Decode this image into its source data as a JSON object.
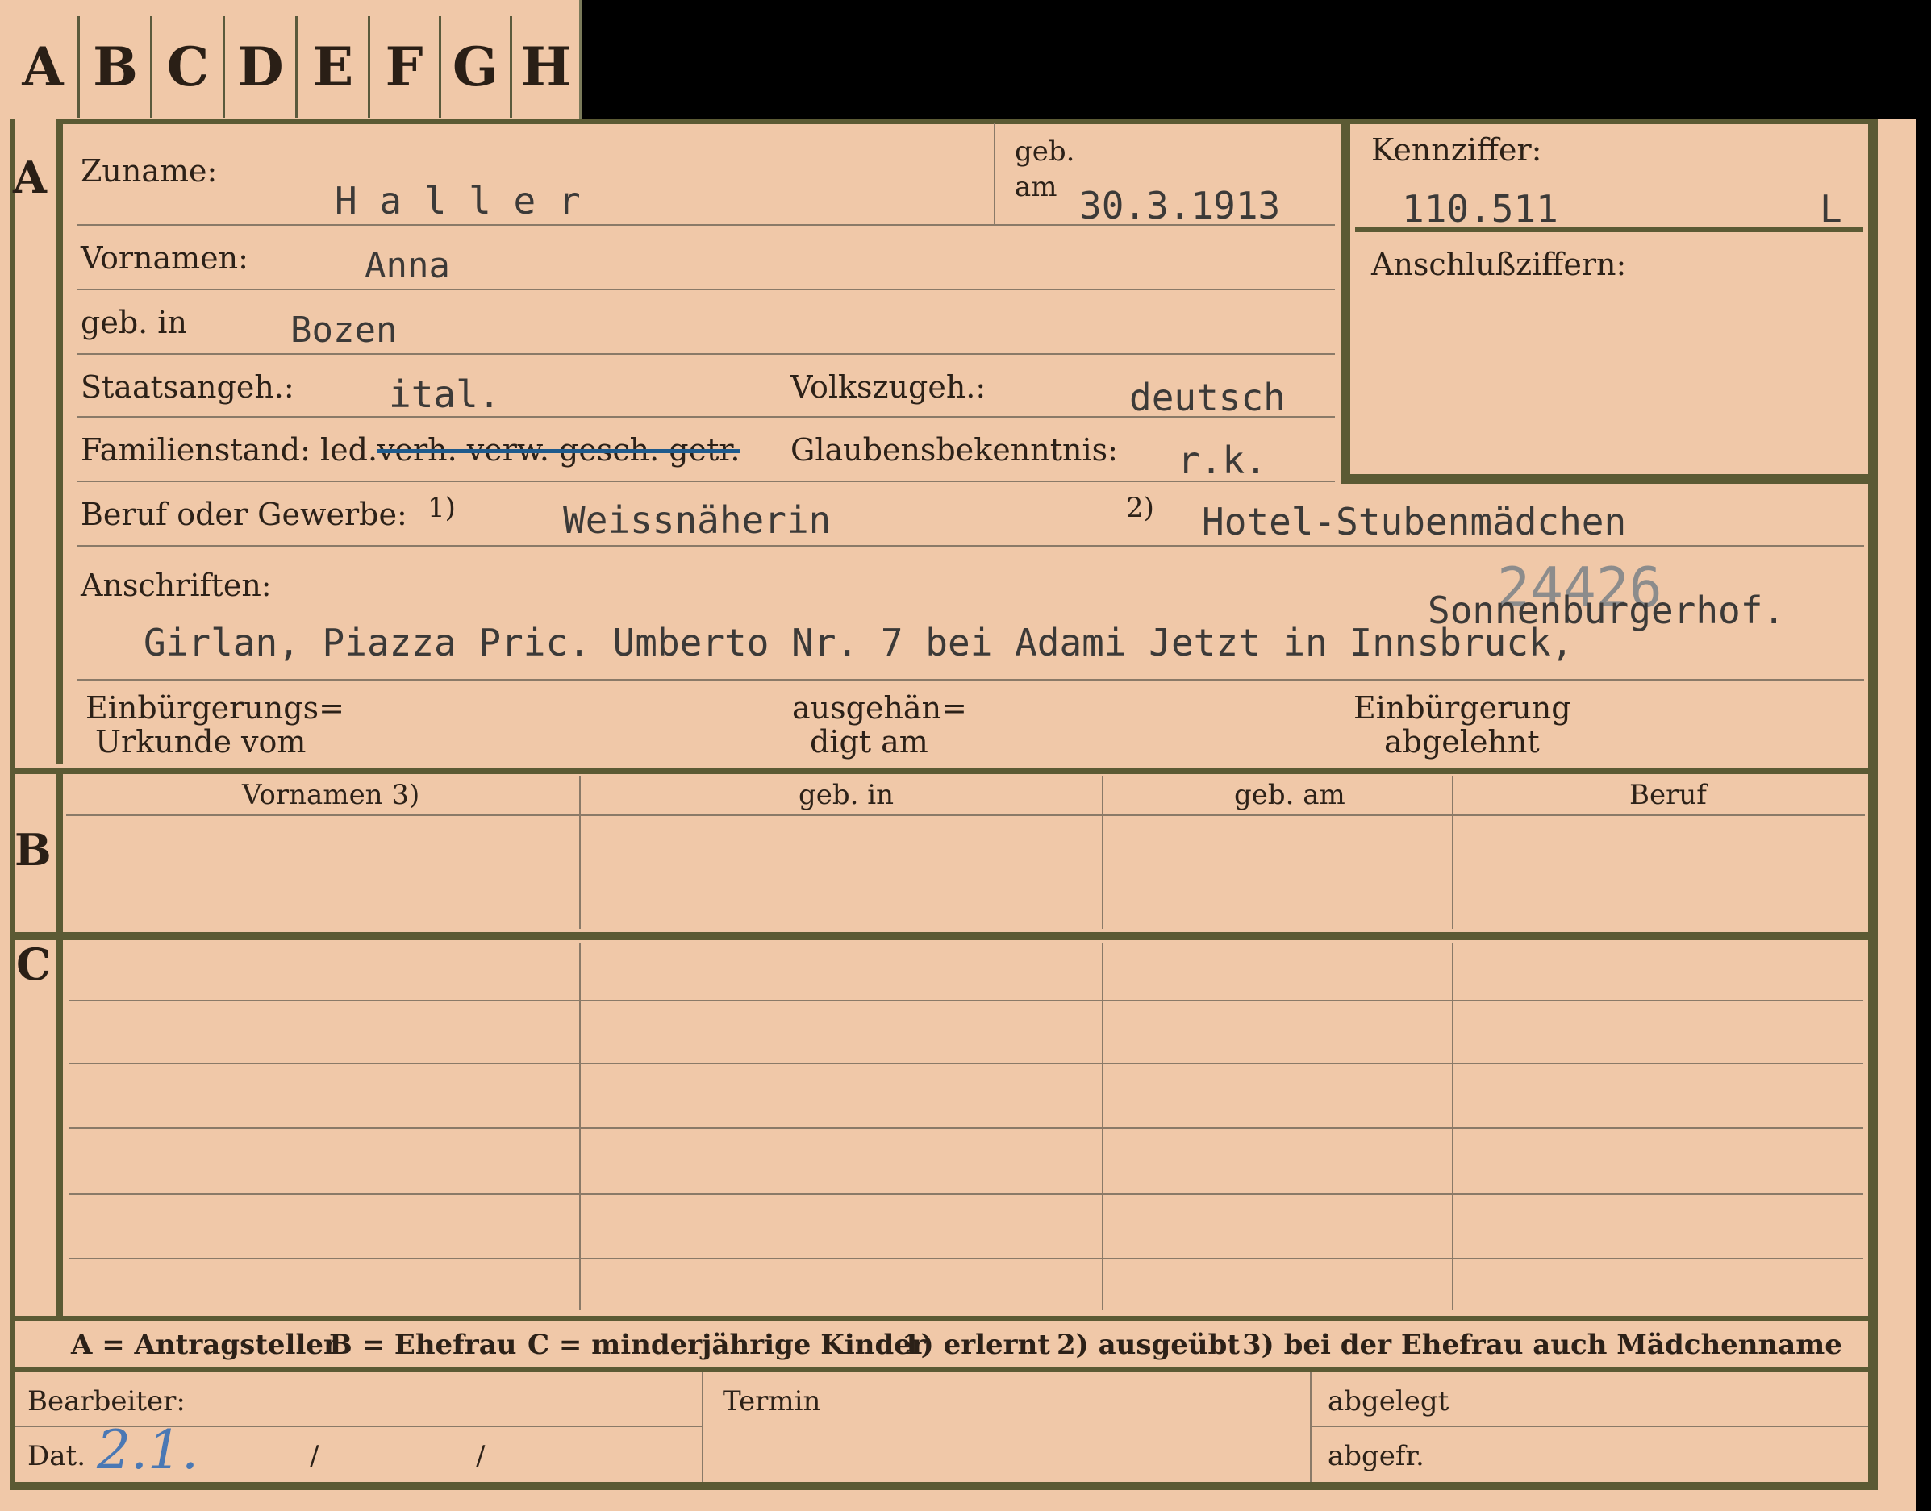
{
  "tabs": [
    "A",
    "B",
    "C",
    "D",
    "E",
    "F",
    "G",
    "H"
  ],
  "section_letters": {
    "a": "A",
    "b": "B",
    "c": "C"
  },
  "labels": {
    "zuname": "Zuname:",
    "geb_am_1": "geb.",
    "geb_am_2": "am",
    "vornamen": "Vornamen:",
    "geb_in": "geb. in",
    "staatsangeh": "Staatsangeh.:",
    "volkszugeh": "Volkszugeh.:",
    "familienstand": "Familienstand: led.",
    "familienstand_struck": "verh. verw. gesch. getr.",
    "glaubensbekenntnis": "Glaubensbekenntnis:",
    "beruf": "Beruf oder Gewerbe:",
    "note1": "1)",
    "note2": "2)",
    "anschriften": "Anschriften:",
    "einbuerg_urkunde_1": "Einbürgerungs=",
    "einbuerg_urkunde_2": "Urkunde vom",
    "ausgehaendigt_1": "ausgehän=",
    "ausgehaendigt_2": "digt am",
    "einbuerg_abgelehnt_1": "Einbürgerung",
    "einbuerg_abgelehnt_2": "abgelehnt",
    "kennziffer": "Kennziffer:",
    "anschlussziffern": "Anschlußziffern:"
  },
  "values": {
    "zuname": "H a l l e r",
    "geb_am": "30.3.1913",
    "vornamen": "Anna",
    "geb_in": "Bozen",
    "staatsangeh": "ital.",
    "volkszugeh": "deutsch",
    "glaubensbekenntnis": "r.k.",
    "beruf1": "Weissnäherin",
    "beruf2": "Hotel-Stubenmädchen",
    "stamp_number": "24426",
    "anschrift_line1": "Sonnenburgerhof.",
    "anschrift_line2": "Girlan, Piazza Pric. Umberto Nr. 7 bei Adami Jetzt in Innsbruck,",
    "kennziffer": "110.511",
    "kennziffer_suffix": "L",
    "dat_handwritten": "2.1."
  },
  "table": {
    "headers": [
      "Vornamen 3)",
      "geb. in",
      "geb. am",
      "Beruf"
    ]
  },
  "legend": {
    "a": "A = Antragsteller",
    "b": "B = Ehefrau",
    "c": "C = minderjährige Kinder",
    "n1": "1) erlernt",
    "n2": "2) ausgeübt",
    "n3": "3) bei der Ehefrau auch Mädchenname"
  },
  "bottom": {
    "bearbeiter": "Bearbeiter:",
    "dat": "Dat.",
    "slash1": "/",
    "slash2": "/",
    "termin": "Termin",
    "abgelegt": "abgelegt",
    "abgefr": "abgefr."
  },
  "colors": {
    "card": "#f0c8a8",
    "frame": "#5b5a34",
    "ink_typed": "#3c3a38",
    "ink_blue": "#4a78b4",
    "stamp": "#8c8c8c",
    "strike": "#1e5a8c"
  }
}
